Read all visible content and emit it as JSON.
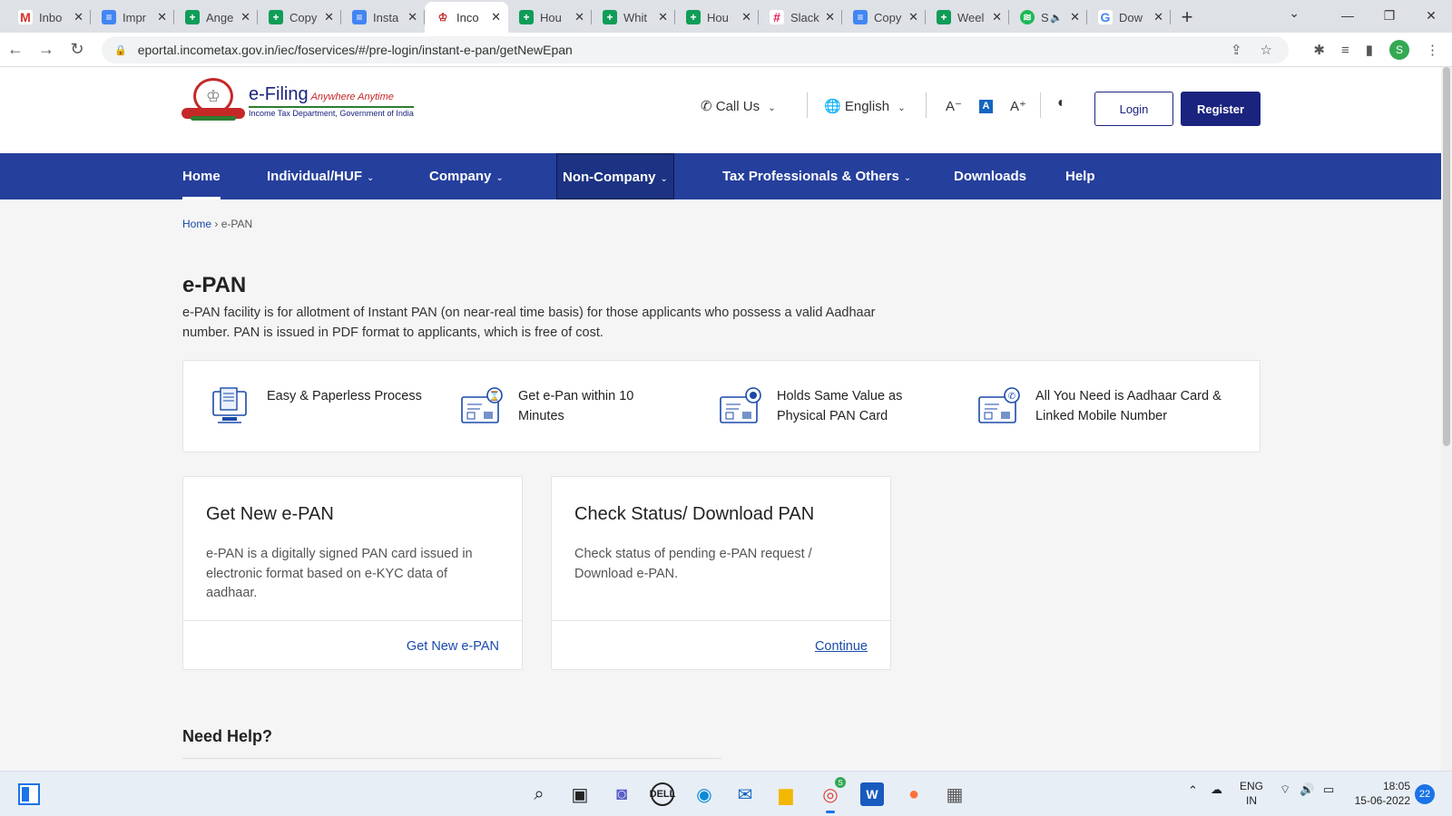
{
  "browser": {
    "tabs": [
      {
        "label": "Inbo",
        "icon": "gmail-icon",
        "glyph": "M",
        "cls": "gmail"
      },
      {
        "label": "Impr",
        "icon": "google-docs-icon",
        "glyph": "≡",
        "cls": "docs"
      },
      {
        "label": "Ange",
        "icon": "google-sheets-icon",
        "glyph": "+",
        "cls": "sheets"
      },
      {
        "label": "Copy",
        "icon": "google-sheets-icon",
        "glyph": "+",
        "cls": "sheets"
      },
      {
        "label": "Insta",
        "icon": "google-docs-icon",
        "glyph": "≡",
        "cls": "docs"
      },
      {
        "label": "Inco",
        "icon": "income-tax-emblem-icon",
        "glyph": "♔",
        "cls": "itd"
      },
      {
        "label": "Hou",
        "icon": "google-sheets-icon",
        "glyph": "+",
        "cls": "sheets"
      },
      {
        "label": "Whit",
        "icon": "google-sheets-icon",
        "glyph": "+",
        "cls": "sheets"
      },
      {
        "label": "Hou",
        "icon": "google-sheets-icon",
        "glyph": "+",
        "cls": "sheets"
      },
      {
        "label": "Slack",
        "icon": "slack-icon",
        "glyph": "#",
        "cls": "slack"
      },
      {
        "label": "Copy",
        "icon": "google-docs-icon",
        "glyph": "≡",
        "cls": "docs"
      },
      {
        "label": "Weel",
        "icon": "google-sheets-icon",
        "glyph": "+",
        "cls": "sheets"
      },
      {
        "label": "S",
        "icon": "spotify-icon",
        "glyph": "≋",
        "cls": "spotify"
      },
      {
        "label": "Dow",
        "icon": "google-icon",
        "glyph": "G",
        "cls": "google"
      }
    ],
    "active_tab": 5,
    "url": "eportal.incometax.gov.in/iec/foservices/#/pre-login/instant-e-pan/getNewEpan",
    "profile_initial": "S"
  },
  "header": {
    "logo_title": "e-Filing",
    "logo_tagline": "Anywhere Anytime",
    "logo_subtitle": "Income Tax Department, Government of India",
    "call_us": "Call Us",
    "language": "English",
    "font_decrease": "A⁻",
    "font_default": "A",
    "font_increase": "A⁺",
    "login": "Login",
    "register": "Register"
  },
  "nav": {
    "home": "Home",
    "individual": "Individual/HUF",
    "company": "Company",
    "non_company": "Non-Company",
    "tax_professionals": "Tax Professionals & Others",
    "downloads": "Downloads",
    "help": "Help"
  },
  "breadcrumb": {
    "home": "Home",
    "current": "e-PAN"
  },
  "page": {
    "title": "e-PAN",
    "intro": "e-PAN facility is for allotment of Instant PAN (on near-real time basis) for those applicants who possess a valid Aadhaar number. PAN is issued in PDF format to applicants, which is free of cost."
  },
  "features": [
    {
      "text": "Easy & Paperless Process"
    },
    {
      "text": "Get e-Pan within 10 Minutes"
    },
    {
      "text": "Holds Same Value as Physical PAN Card"
    },
    {
      "text": "All You Need is Aadhaar Card & Linked Mobile Number"
    }
  ],
  "cards": [
    {
      "title": "Get New e-PAN",
      "description": "e-PAN is a digitally signed PAN card issued in electronic format based on e-KYC data of aadhaar.",
      "link": "Get New e-PAN"
    },
    {
      "title": "Check Status/ Download PAN",
      "description": "Check status of pending e-PAN request / Download e-PAN.",
      "link": "Continue"
    }
  ],
  "need_help": "Need Help?",
  "taskbar": {
    "lang_line1": "ENG",
    "lang_line2": "IN",
    "time": "18:05",
    "date": "15-06-2022",
    "notifications": "22",
    "chrome_badge": "S"
  }
}
